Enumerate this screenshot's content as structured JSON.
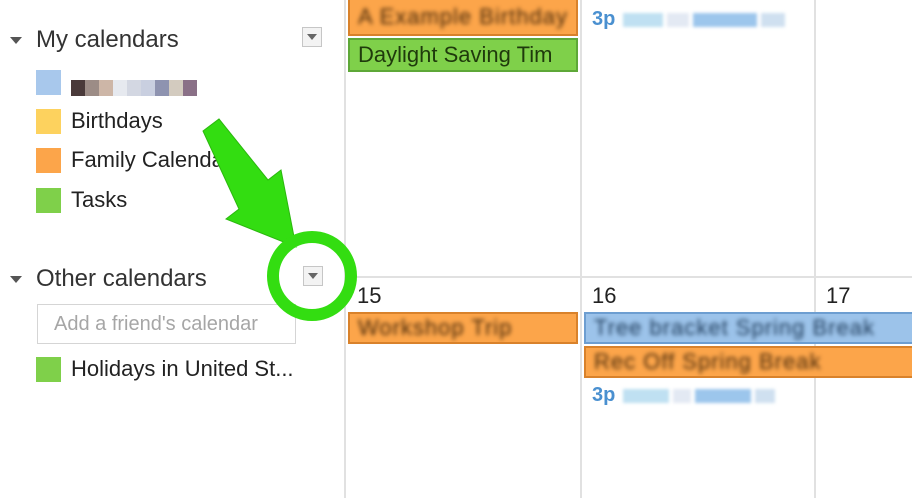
{
  "colors": {
    "my_cal_swatch": "#a8c8ec",
    "birthdays": "#fdd25e",
    "family": "#fca54a",
    "tasks": "#7fd04a",
    "holidays": "#7fd04a",
    "annotation": "#33dd11"
  },
  "sidebar": {
    "my_calendars": {
      "label": "My calendars",
      "items": [
        {
          "label": "Birthdays"
        },
        {
          "label": "Family Calendar"
        },
        {
          "label": "Tasks"
        }
      ]
    },
    "other_calendars": {
      "label": "Other calendars",
      "add_placeholder": "Add a friend's calendar",
      "items": [
        {
          "label": "Holidays in United St..."
        }
      ]
    }
  },
  "calendar": {
    "day_numbers": [
      "15",
      "16",
      "17"
    ],
    "events": {
      "daylight": "Daylight Saving Tim",
      "blurred_top": "A Example Birthday",
      "blurred_15": "Workshop Trip",
      "blurred_16a": "Tree bracket Spring Break",
      "blurred_16b": "Rec Off Spring Break",
      "timed_top": "3p",
      "timed_16": "3p"
    }
  }
}
